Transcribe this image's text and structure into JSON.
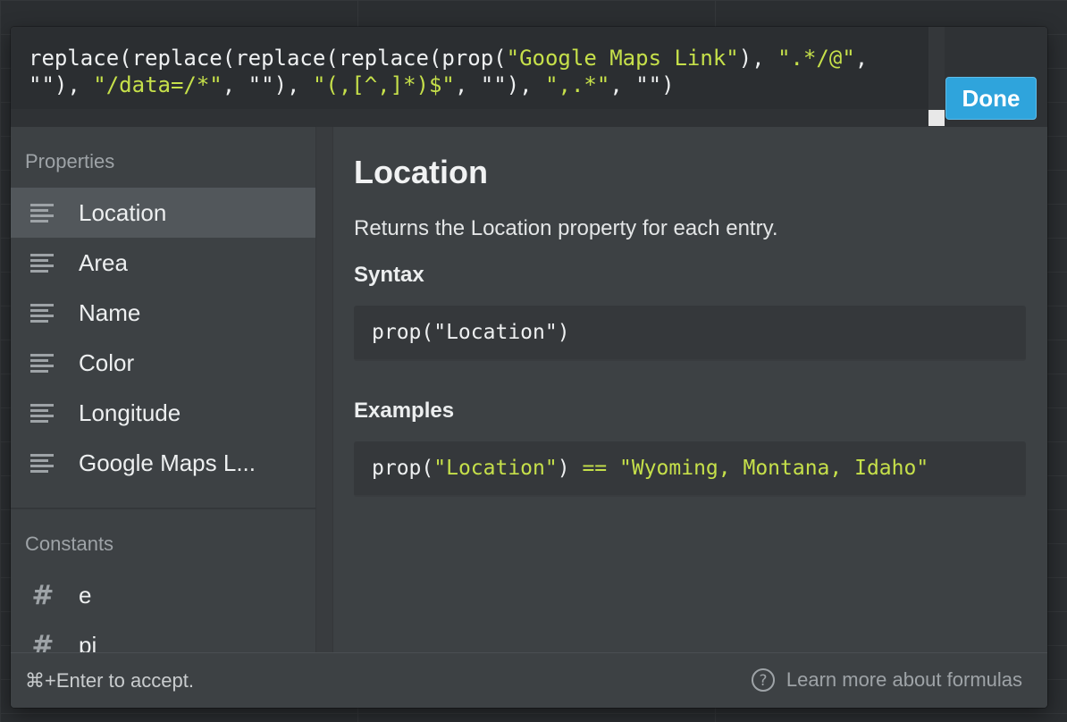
{
  "editor": {
    "formula_parts": [
      {
        "t": "replace(replace(replace(replace(prop(",
        "c": "plain"
      },
      {
        "t": "\"Google Maps Link\"",
        "c": "str"
      },
      {
        "t": "), ",
        "c": "plain"
      },
      {
        "t": "\".*/@\"",
        "c": "str"
      },
      {
        "t": ", ",
        "c": "plain"
      },
      {
        "t": "\"\"",
        "c": "plain"
      },
      {
        "t": "), ",
        "c": "plain"
      },
      {
        "t": "\"/data=/*\"",
        "c": "str"
      },
      {
        "t": ", ",
        "c": "plain"
      },
      {
        "t": "\"\"",
        "c": "plain"
      },
      {
        "t": "), ",
        "c": "plain"
      },
      {
        "t": "\"(,[^,]*)$\"",
        "c": "str"
      },
      {
        "t": ", ",
        "c": "plain"
      },
      {
        "t": "\"\"",
        "c": "plain"
      },
      {
        "t": "), ",
        "c": "plain"
      },
      {
        "t": "\",.*\"",
        "c": "str"
      },
      {
        "t": ", ",
        "c": "plain"
      },
      {
        "t": "\"\"",
        "c": "plain"
      },
      {
        "t": ")",
        "c": "plain"
      }
    ],
    "done_label": "Done"
  },
  "sidebar": {
    "properties_title": "Properties",
    "properties": [
      {
        "label": "Location",
        "icon": "text-lines-icon",
        "active": true
      },
      {
        "label": "Area",
        "icon": "text-lines-icon"
      },
      {
        "label": "Name",
        "icon": "text-lines-icon"
      },
      {
        "label": "Color",
        "icon": "text-lines-icon"
      },
      {
        "label": "Longitude",
        "icon": "text-lines-icon"
      },
      {
        "label": "Google Maps L...",
        "icon": "text-lines-icon"
      }
    ],
    "constants_title": "Constants",
    "constants": [
      {
        "label": "e",
        "icon": "hash-icon"
      },
      {
        "label": "pi",
        "icon": "hash-icon"
      }
    ]
  },
  "detail": {
    "title": "Location",
    "description": "Returns the Location property for each entry.",
    "syntax_heading": "Syntax",
    "syntax_code": "prop(\"Location\")",
    "examples_heading": "Examples",
    "example_parts": {
      "p1": "prop(",
      "p2": "\"Location\"",
      "p3": ") ",
      "p4": "==",
      "p5": " ",
      "p6": "\"Wyoming, Montana, Idaho\""
    }
  },
  "footer": {
    "hint": "⌘+Enter to accept.",
    "learn_more": "Learn more about formulas"
  },
  "colors": {
    "accent": "#2fa4dc",
    "string": "#c6e04a",
    "panel": "#3d4144",
    "active_row": "#52575b"
  }
}
